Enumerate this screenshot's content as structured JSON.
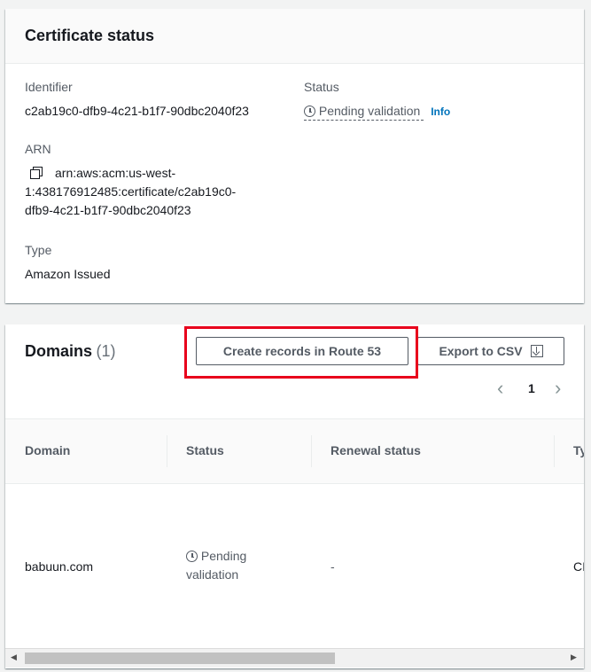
{
  "certificate_status": {
    "title": "Certificate status",
    "identifier_label": "Identifier",
    "identifier_value": "c2ab19c0-dfb9-4c21-b1f7-90dbc2040f23",
    "status_label": "Status",
    "status_value": "Pending validation",
    "info_link": "Info",
    "arn_label": "ARN",
    "arn_line1": "arn:aws:acm:us-west-",
    "arn_line2": "1:438176912485:certificate/c2ab19c0-",
    "arn_line3": "dfb9-4c21-b1f7-90dbc2040f23",
    "type_label": "Type",
    "type_value": "Amazon Issued"
  },
  "domains": {
    "title": "Domains",
    "count": "(1)",
    "create_records_button": "Create records in Route 53",
    "export_button": "Export to CSV",
    "page_number": "1",
    "columns": [
      "Domain",
      "Status",
      "Renewal status",
      "Ty"
    ],
    "rows": [
      {
        "domain": "babuun.com",
        "status_line1": "Pending",
        "status_line2": "validation",
        "renewal_status": "-",
        "type": "CI"
      }
    ]
  }
}
